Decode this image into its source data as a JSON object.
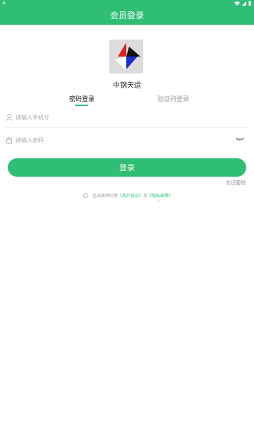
{
  "status_bar": {
    "left_label": "A"
  },
  "header": {
    "title": "会员登录"
  },
  "company": {
    "name": "中钢天运"
  },
  "tabs": {
    "password_login": "密码登录",
    "code_login": "验证码登录"
  },
  "form": {
    "phone_placeholder": "请输入手机号",
    "password_placeholder": "请输入密码",
    "login_button": "登录",
    "forgot_password": "忘记密码"
  },
  "agreement": {
    "prefix": "已阅读并同意",
    "user_agreement": "《用户协议》",
    "and": "及",
    "privacy_policy": "《隐私政策》"
  },
  "colors": {
    "brand": "#2fbe74",
    "logo_bg": "#dcdcdc"
  }
}
